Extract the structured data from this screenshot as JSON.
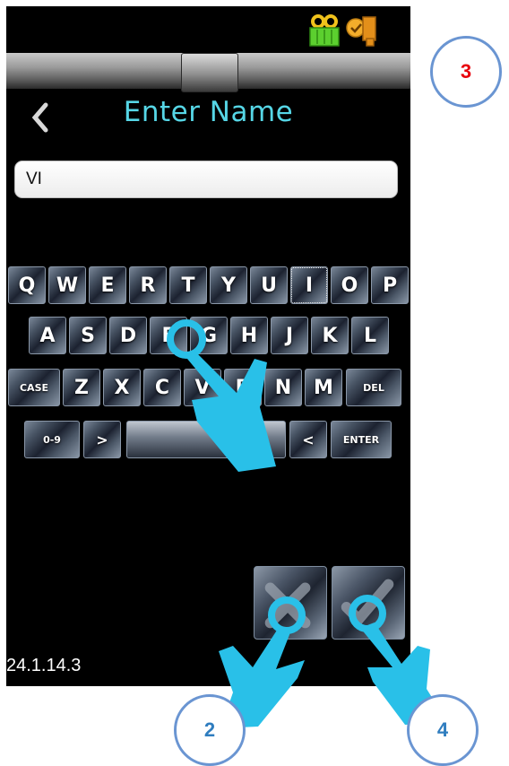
{
  "status_bar": {
    "icons": [
      "recorder-icon",
      "lock-check-icon"
    ]
  },
  "header": {
    "title": "Enter Name",
    "back_icon": "chevron-left-icon"
  },
  "name_field": {
    "value": "VI"
  },
  "keyboard": {
    "row1": [
      "Q",
      "W",
      "E",
      "R",
      "T",
      "Y",
      "U",
      "I",
      "O",
      "P"
    ],
    "row2": [
      "A",
      "S",
      "D",
      "F",
      "G",
      "H",
      "J",
      "K",
      "L"
    ],
    "row3": [
      "CASE",
      "Z",
      "X",
      "C",
      "V",
      "B",
      "N",
      "M",
      "DEL"
    ],
    "row4": [
      "0-9",
      ">",
      "",
      "<",
      "ENTER"
    ],
    "selected_key": "I"
  },
  "actions": {
    "cancel_icon": "cancel-icon",
    "confirm_icon": "confirm-icon"
  },
  "footer": {
    "version": "24.1.14.3"
  },
  "annotations": {
    "step_2": "2",
    "step_3": "3",
    "step_4": "4",
    "step_3_color": "#e8000b",
    "step_color": "#2f7dbf",
    "hand_color": "#29c0e8"
  }
}
